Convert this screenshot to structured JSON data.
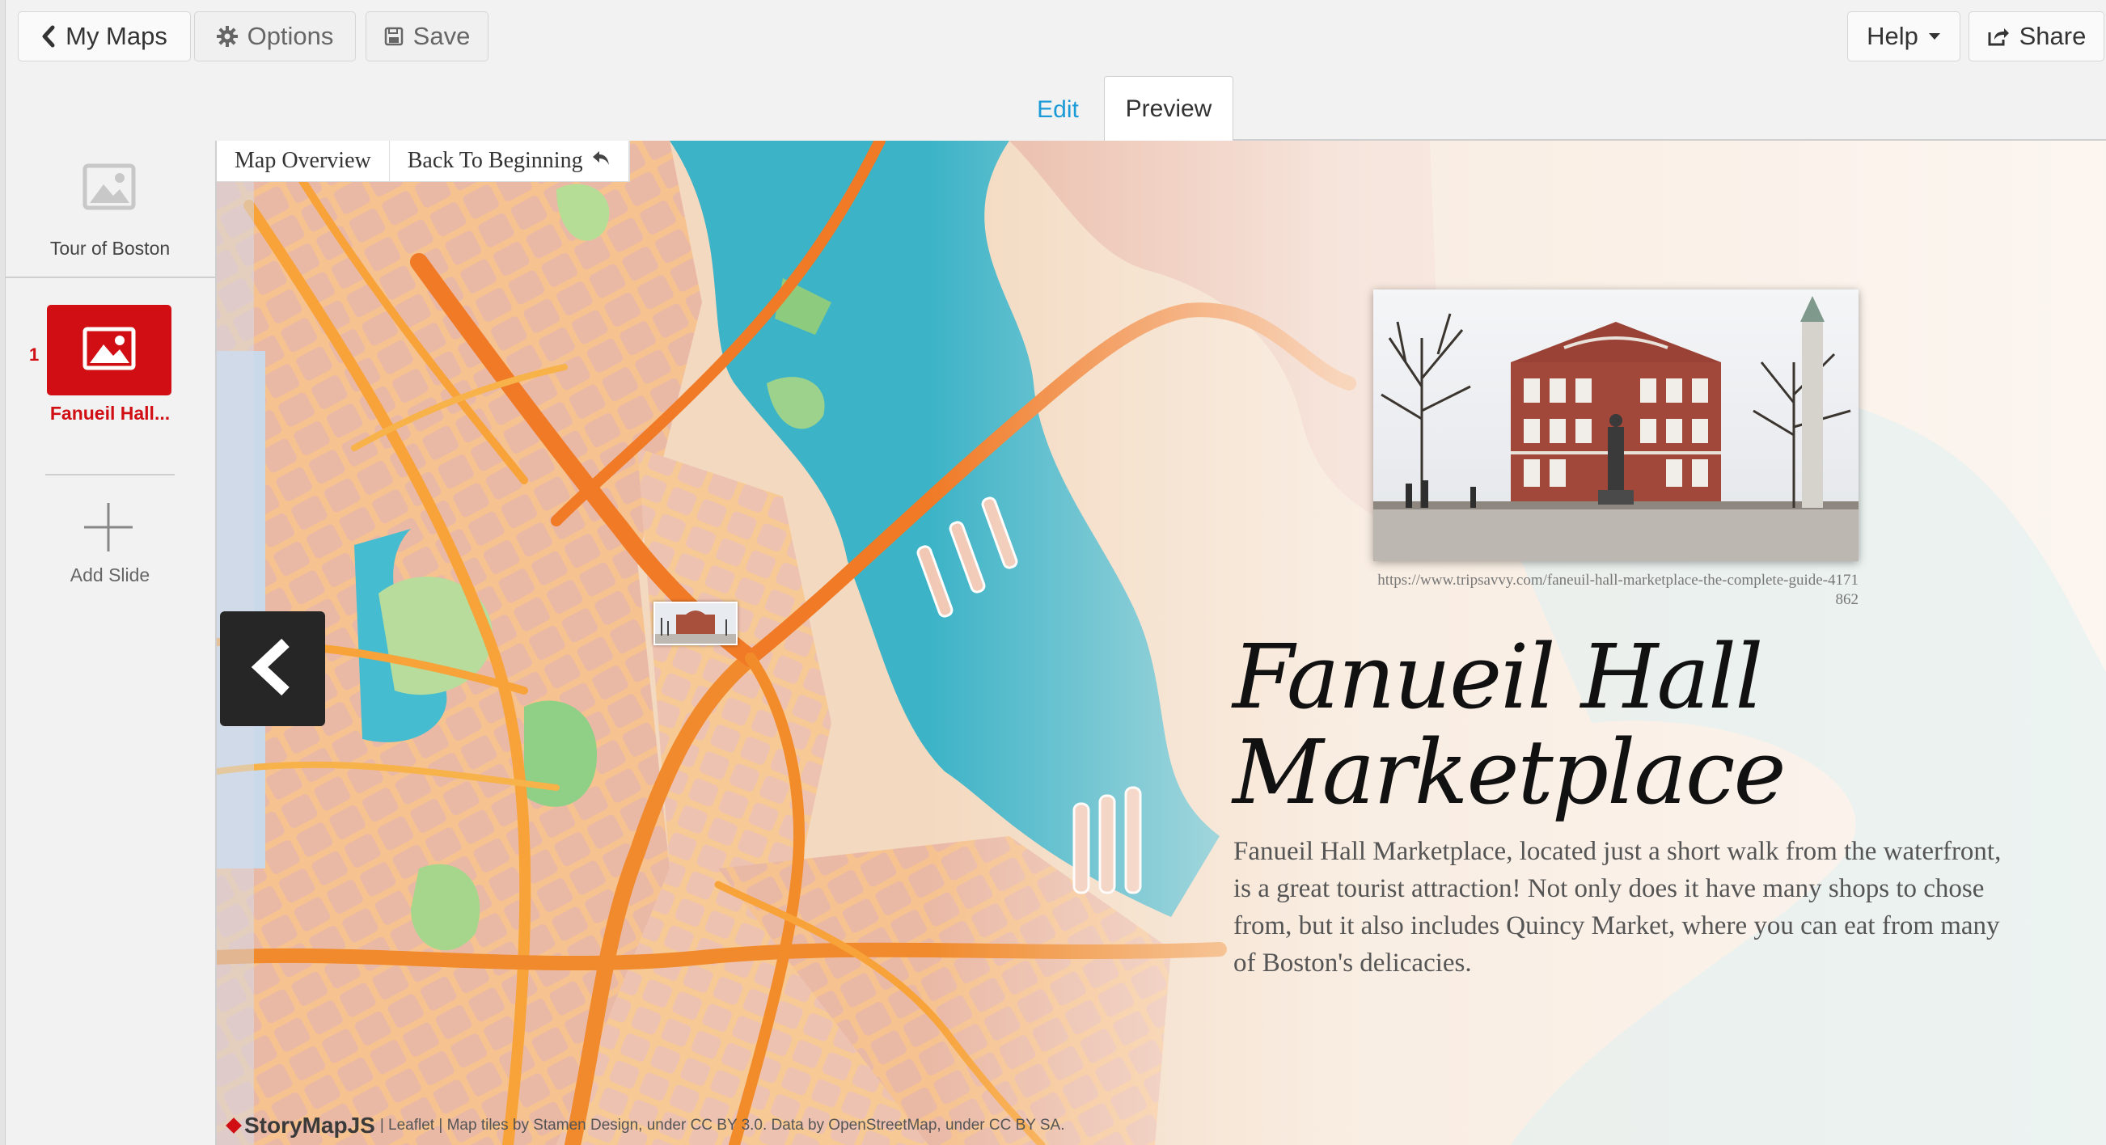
{
  "toolbar": {
    "my_maps_label": "My Maps",
    "options_label": "Options",
    "save_label": "Save",
    "help_label": "Help",
    "share_label": "Share"
  },
  "tabs": {
    "edit": "Edit",
    "preview": "Preview"
  },
  "sidebar": {
    "slides": [
      {
        "label": "Tour of Boston",
        "icon": "image-icon",
        "type": "overview"
      },
      {
        "number": "1",
        "label": "Fanueil Hall...",
        "icon": "image-icon",
        "active": true
      }
    ],
    "add_slide_label": "Add Slide"
  },
  "map_nav": {
    "overview": "Map Overview",
    "back": "Back To Beginning"
  },
  "slide": {
    "image_credit": "https://www.tripsavvy.com/faneuil-hall-marketplace-the-complete-guide-4171862",
    "headline": "Fanueil Hall Marketplace",
    "body": "Fanueil Hall Marketplace, located just a short walk from the waterfront, is a great tourist attraction! Not only does it have many shops to chose from, but it also includes Quincy Market, where you can eat from many of Boston's delicacies."
  },
  "attribution": {
    "brand": "StoryMapJS",
    "text": "| Leaflet | Map tiles by Stamen Design, under CC BY 3.0. Data by OpenStreetMap, under CC BY SA."
  },
  "colors": {
    "accent_blue": "#1a9bd7",
    "active_red": "#d00e13",
    "water": "#3fb6c9",
    "road_orange": "#f07a26"
  }
}
